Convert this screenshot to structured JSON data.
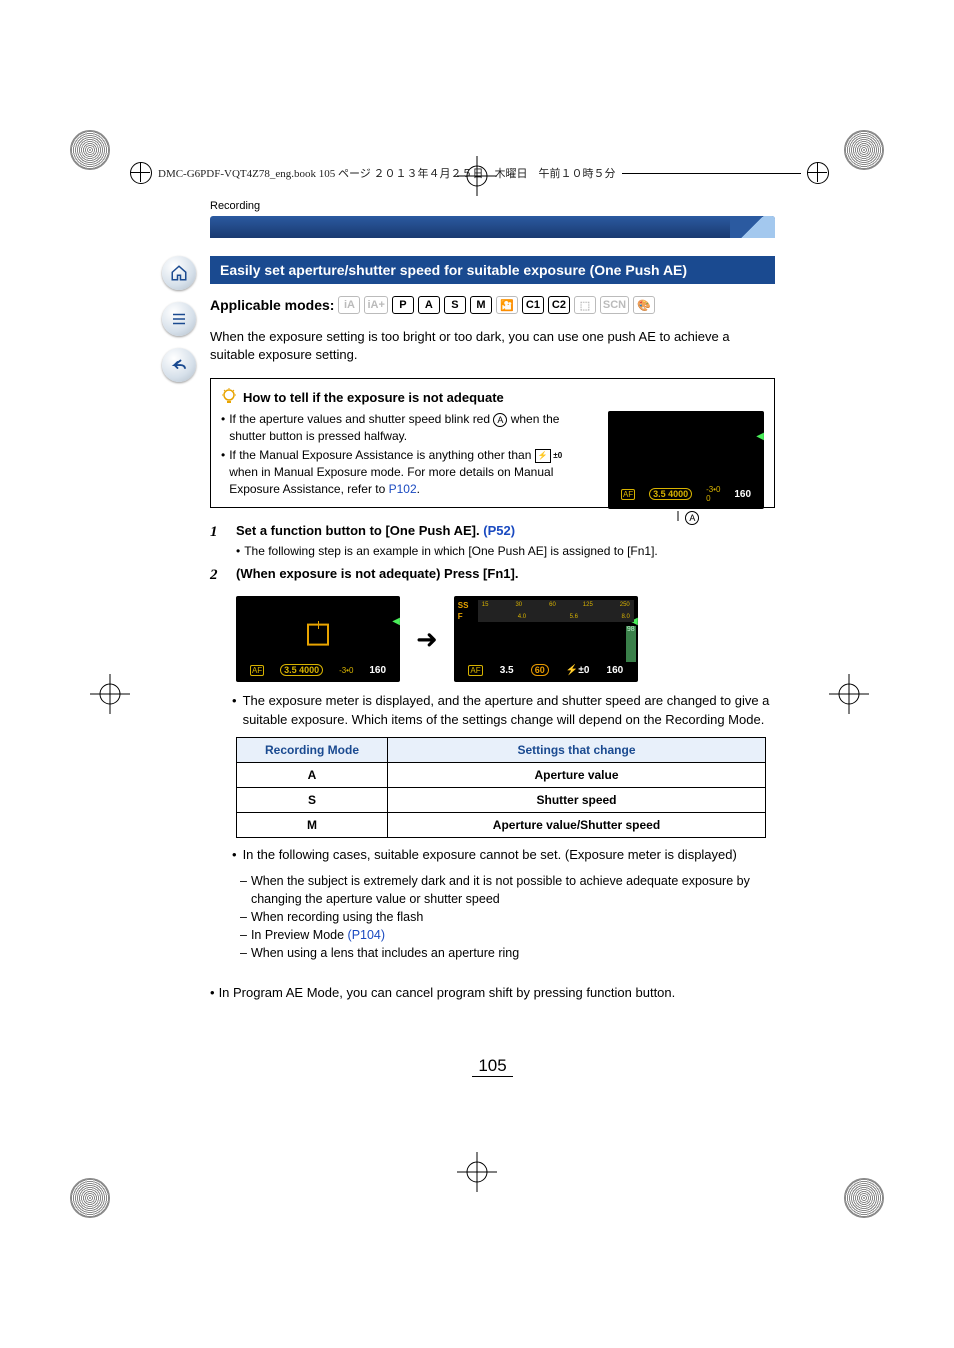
{
  "header": {
    "filename": "DMC-G6PDF-VQT4Z78_eng.book  105 ページ  ２０１３年４月２５日　木曜日　午前１０時５分"
  },
  "section_label": "Recording",
  "title": "Easily set aperture/shutter speed for suitable exposure (One Push AE)",
  "applicable_label": "Applicable modes:",
  "modes": {
    "p": "P",
    "a": "A",
    "s": "S",
    "m": "M",
    "c1": "C1",
    "c2": "C2"
  },
  "intro": "When the exposure setting is too bright or too dark, you can use one push AE to achieve a suitable exposure setting.",
  "infobox": {
    "heading": "How to tell if the exposure is not adequate",
    "b1a": "If the aperture values and shutter speed blink red ",
    "b1b": " when the shutter button is pressed halfway.",
    "b2a": "If the Manual Exposure Assistance is anything other than ",
    "b2b": " when in Manual Exposure mode. For more details on Manual Exposure Assistance, refer to ",
    "b2link": "P102",
    "b2end": ".",
    "callout_a": "A",
    "lcd_a": {
      "aperture": "3.5",
      "shutter": "4000",
      "exp": "0",
      "count": "160"
    }
  },
  "steps": {
    "s1": {
      "num": "1",
      "main": "Set a function button to [One Push AE]. ",
      "link": "(P52)",
      "sub": "The following step is an example in which [One Push AE] is assigned to [Fn1]."
    },
    "s2": {
      "num": "2",
      "main": "(When exposure is not adequate) Press [Fn1]."
    }
  },
  "screens": {
    "left": {
      "aperture": "3.5",
      "shutter": "4000",
      "exp": "0",
      "count": "160"
    },
    "right": {
      "ss": "SS",
      "f": "F",
      "top": [
        "15",
        "30",
        "60",
        "125",
        "250"
      ],
      "bot": [
        "4.0",
        "5.6",
        "8.0"
      ],
      "strip": {
        "ap": "3.5",
        "sh": "60",
        "ev": "±0",
        "ct": "160"
      },
      "badge": "98"
    }
  },
  "note1": "The exposure meter is displayed, and the aperture and shutter speed are changed to give a suitable exposure. Which items of the settings change will depend on the Recording Mode.",
  "table": {
    "h1": "Recording Mode",
    "h2": "Settings that change",
    "rows": [
      {
        "mode": "A",
        "change": "Aperture value"
      },
      {
        "mode": "S",
        "change": "Shutter speed"
      },
      {
        "mode": "M",
        "change": "Aperture value/Shutter speed"
      }
    ]
  },
  "note2": "In the following cases, suitable exposure cannot be set. (Exposure meter is displayed)",
  "dashes": {
    "d1": "When the subject is extremely dark and it is not possible to achieve adequate exposure by changing the aperture value or shutter speed",
    "d2": "When recording using the flash",
    "d3a": "In Preview Mode ",
    "d3link": "(P104)",
    "d4": "When using a lens that includes an aperture ring"
  },
  "footnote": "In Program AE Mode, you can cancel program shift by pressing function button.",
  "page_number": "105"
}
